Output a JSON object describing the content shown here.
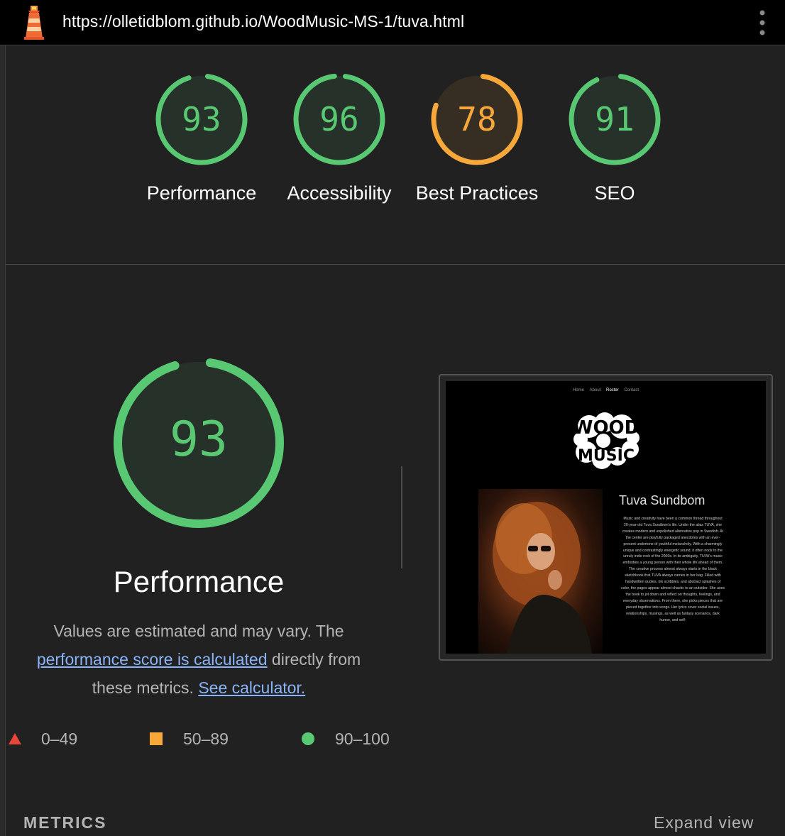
{
  "header": {
    "url": "https://olletidblom.github.io/WoodMusic-MS-1/tuva.html",
    "logo_icon": "lighthouse-icon",
    "menu_icon": "more-vert-icon"
  },
  "colors": {
    "pass": "#58c972",
    "average": "#f7a83b",
    "fail": "#e9453a",
    "link": "#8ab4f8",
    "background": "#212121"
  },
  "gauges": [
    {
      "score": 93,
      "label": "Performance",
      "rating": "pass"
    },
    {
      "score": 96,
      "label": "Accessibility",
      "rating": "pass"
    },
    {
      "score": 78,
      "label": "Best Practices",
      "rating": "average"
    },
    {
      "score": 91,
      "label": "SEO",
      "rating": "pass"
    }
  ],
  "performance": {
    "score": 93,
    "title": "Performance",
    "desc_part1": "Values are estimated and may vary. The ",
    "link_calculated": "performance score is calculated",
    "desc_part2": " directly from these metrics. ",
    "link_calculator": "See calculator."
  },
  "legend": [
    {
      "range": "0–49",
      "icon": "triangle-icon"
    },
    {
      "range": "50–89",
      "icon": "square-icon"
    },
    {
      "range": "90–100",
      "icon": "circle-icon"
    }
  ],
  "screenshot": {
    "nav": [
      "Home",
      "About",
      "Roster",
      "Contact"
    ],
    "logo_text_1": "WOOD",
    "logo_text_2": "MUSIC",
    "artist_name": "Tuva Sundbom",
    "bio": "Music and creativity have been a common thread throughout 20-year-old Tuva Sundbom's life. Under the alias TUVA, she creates modern and unpolished alternative pop in Swedish. At the center are playfully packaged anecdotes with an ever-present undertone of youthful melancholy. With a charmingly unique and contrastingly energetic sound, it often nods to the unruly indie rock of the 2000s. In its ambiguity, TUVA's music embodies a young person with their whole life ahead of them. The creative process almost always starts in the black sketchbook that TUVA always carries in her bag. Filled with handwritten quotes, ink scribbles, and abstract splashes of color, the pages appear almost chaotic to an outsider. She uses the book to jot down and reflect on thoughts, feelings, and everyday observations. From there, she picks pieces that are pieced together into songs. Her lyrics cover social issues, relationships, musings, as well as fantasy scenarios, dark humor, and self-"
  },
  "metrics": {
    "label": "METRICS",
    "expand": "Expand view"
  }
}
